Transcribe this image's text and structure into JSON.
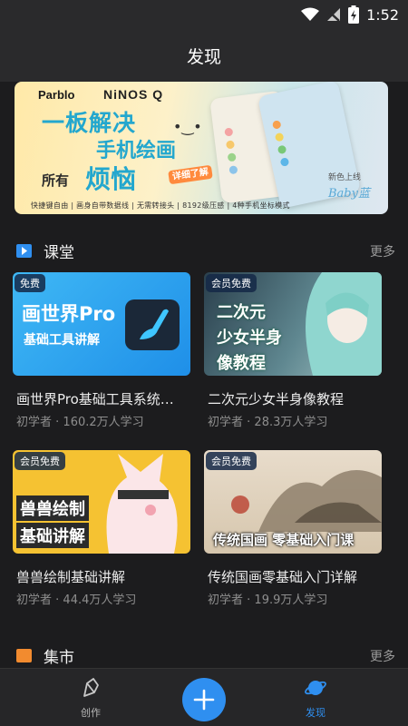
{
  "status_bar": {
    "time": "1:52"
  },
  "app_bar": {
    "title": "发现"
  },
  "banner": {
    "brand": "Parblo",
    "brand_model": "NiNOS Q",
    "headline_1": "一板解决",
    "headline_2": "手机绘画",
    "headline_3a": "所有",
    "headline_3b": "烦恼",
    "detail_label": "详细了解",
    "features": "快捷键自由 | 画身自带数据线 | 无需转接头 | 8192级压感 | 4种手机坐标模式",
    "new_color_label": "新色上线",
    "color_name": "Baby蓝"
  },
  "classroom": {
    "title": "课堂",
    "more": "更多",
    "courses": [
      {
        "badge": "免费",
        "thumb_line1": "画世界Pro",
        "thumb_line2": "基础工具讲解",
        "title": "画世界Pro基础工具系统…",
        "level": "初学者",
        "learners": "160.2万人学习"
      },
      {
        "badge": "会员免费",
        "thumb_line1": "二次元",
        "thumb_line2": "少女半身",
        "thumb_line3": "像教程",
        "title": "二次元少女半身像教程",
        "level": "初学者",
        "learners": "28.3万人学习"
      },
      {
        "badge": "会员免费",
        "thumb_line1": "兽兽绘制",
        "thumb_line2": "基础讲解",
        "title": "兽兽绘制基础讲解",
        "level": "初学者",
        "learners": "44.4万人学习"
      },
      {
        "badge": "会员免费",
        "thumb_line1": "传统国画 零基础入门课",
        "title": "传统国画零基础入门详解",
        "level": "初学者",
        "learners": "19.9万人学习"
      }
    ]
  },
  "market": {
    "title": "集市",
    "more": "更多"
  },
  "bottom_nav": {
    "create_label": "创作",
    "discover_label": "发现",
    "accent": "#2f8ff0"
  },
  "icons": {
    "wifi": "wifi-icon",
    "signal": "signal-off-icon",
    "battery": "battery-charging-icon",
    "classroom": "play-icon",
    "market": "shop-icon",
    "create": "pen-icon",
    "add": "plus-icon",
    "discover": "planet-icon"
  }
}
